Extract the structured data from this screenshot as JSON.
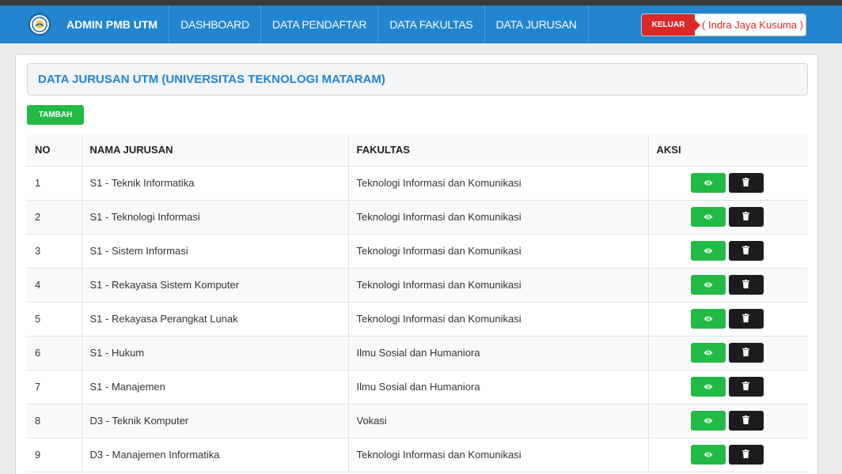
{
  "navbar": {
    "brand": "ADMIN PMB UTM",
    "items": [
      "DASHBOARD",
      "DATA PENDAFTAR",
      "DATA FAKULTAS",
      "DATA JURUSAN"
    ],
    "logout_label": "KELUAR",
    "user_name": "( Indra Jaya Kusuma )"
  },
  "page": {
    "title": "DATA JURUSAN UTM (UNIVERSITAS TEKNOLOGI MATARAM)",
    "add_label": "TAMBAH"
  },
  "table": {
    "columns": [
      "NO",
      "NAMA JURUSAN",
      "FAKULTAS",
      "AKSI"
    ],
    "rows": [
      {
        "no": "1",
        "name": "S1 - Teknik Informatika",
        "fakultas": "Teknologi Informasi dan Komunikasi"
      },
      {
        "no": "2",
        "name": "S1 - Teknologi Informasi",
        "fakultas": "Teknologi Informasi dan Komunikasi"
      },
      {
        "no": "3",
        "name": "S1 - Sistem Informasi",
        "fakultas": "Teknologi Informasi dan Komunikasi"
      },
      {
        "no": "4",
        "name": "S1 - Rekayasa Sistem Komputer",
        "fakultas": "Teknologi Informasi dan Komunikasi"
      },
      {
        "no": "5",
        "name": "S1 - Rekayasa Perangkat Lunak",
        "fakultas": "Teknologi Informasi dan Komunikasi"
      },
      {
        "no": "6",
        "name": "S1 - Hukum",
        "fakultas": "Ilmu Sosial dan Humaniora"
      },
      {
        "no": "7",
        "name": "S1 - Manajemen",
        "fakultas": "Ilmu Sosial dan Humaniora"
      },
      {
        "no": "8",
        "name": "D3 - Teknik Komputer",
        "fakultas": "Vokasi"
      },
      {
        "no": "9",
        "name": "D3 - Manajemen Informatika",
        "fakultas": "Teknologi Informasi dan Komunikasi"
      }
    ]
  },
  "icons": {
    "logo": "university-logo-icon",
    "view": "eye-icon",
    "delete": "trash-icon"
  },
  "colors": {
    "primary": "#2185d0",
    "success": "#21ba45",
    "danger": "#db2828",
    "dark": "#1b1c1d"
  }
}
